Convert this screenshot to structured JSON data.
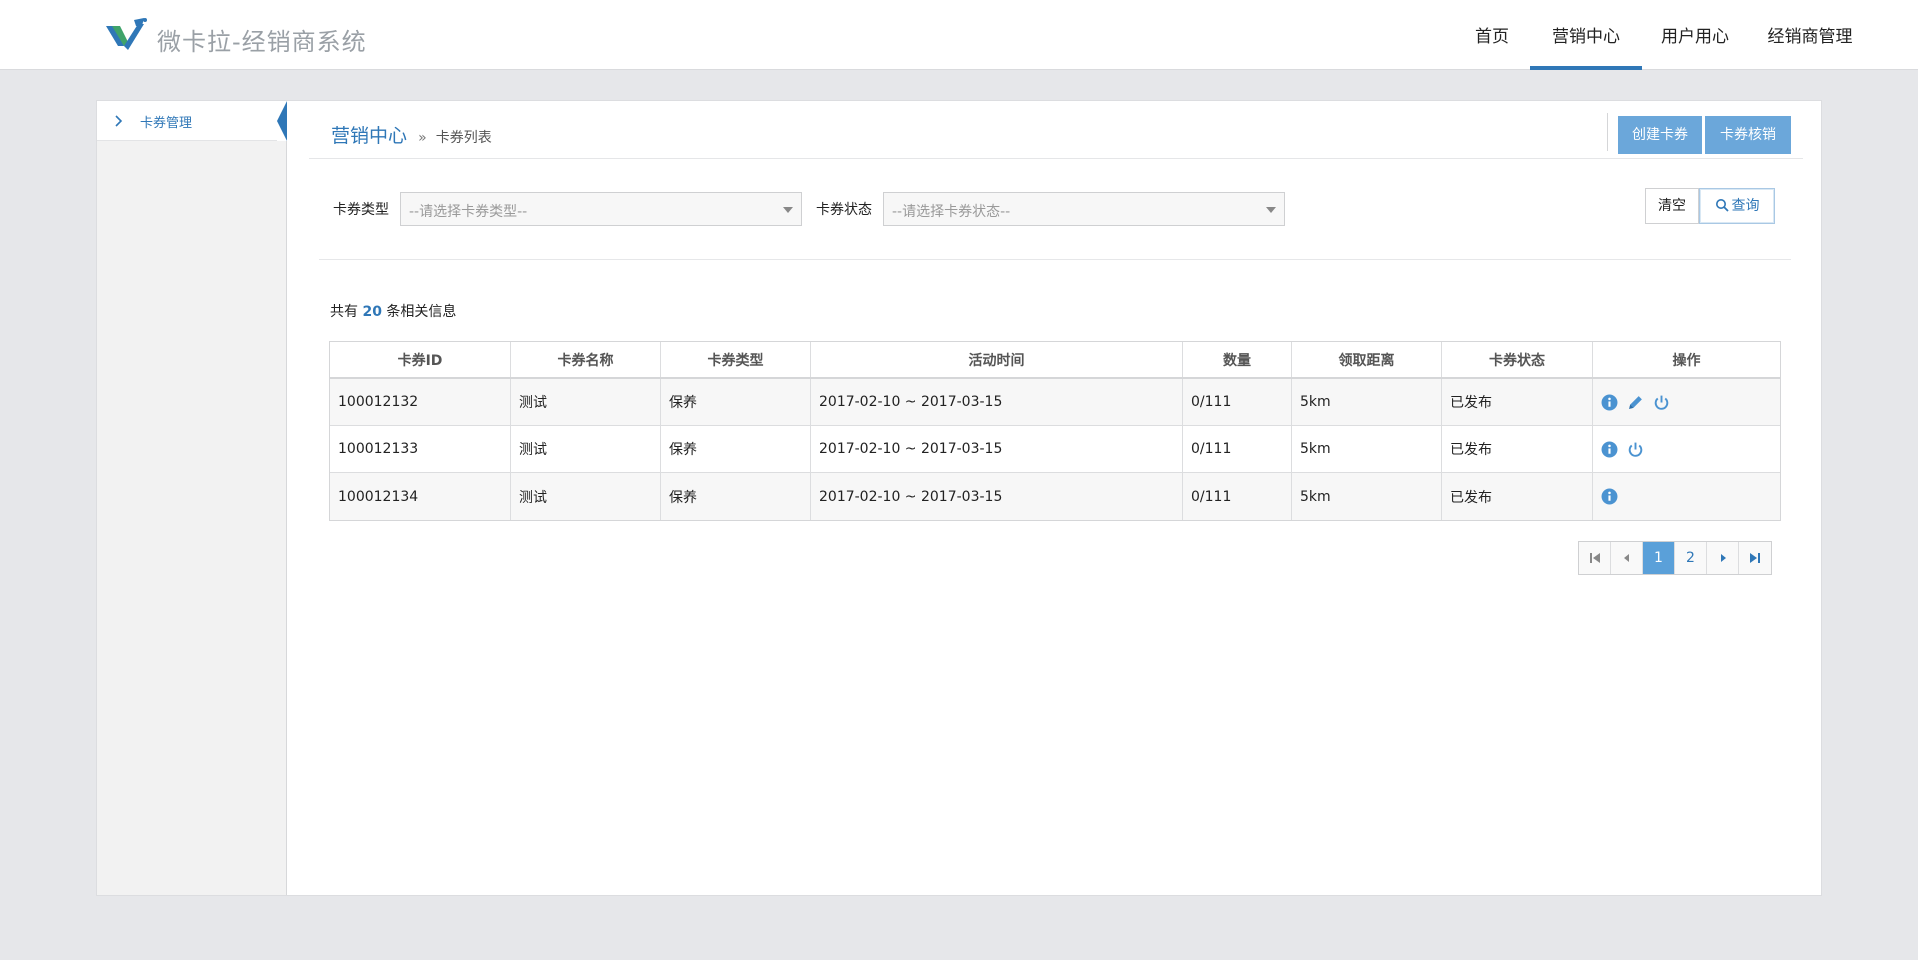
{
  "app": {
    "brand": "微卡拉-经销商系统",
    "logo_icon": "vk-logo-icon",
    "accent_color": "#2f77b7"
  },
  "nav": {
    "items": [
      {
        "label": "首页"
      },
      {
        "label": "营销中心",
        "active": true
      },
      {
        "label": "用户用心"
      },
      {
        "label": "经销商管理"
      }
    ]
  },
  "sidebar": {
    "items": [
      {
        "label": "卡券管理",
        "icon": "chevron-right-icon",
        "active": true
      }
    ]
  },
  "breadcrumb": {
    "main": "营销中心",
    "separator": "»",
    "sub": "卡券列表"
  },
  "header_actions": {
    "create_label": "创建卡券",
    "redeem_label": "卡券核销"
  },
  "filters": {
    "type_label": "卡券类型",
    "type_placeholder": "--请选择卡券类型--",
    "status_label": "卡券状态",
    "status_placeholder": "--请选择卡券状态--",
    "clear_label": "清空",
    "query_label": "查询"
  },
  "summary": {
    "prefix": "共有",
    "count": "20",
    "suffix": "条相关信息"
  },
  "table": {
    "headers": [
      "卡券ID",
      "卡券名称",
      "卡券类型",
      "活动时间",
      "数量",
      "领取距离",
      "卡券状态",
      "操作"
    ],
    "rows": [
      {
        "id": "100012132",
        "name": "测试",
        "type": "保养",
        "period": "2017-02-10 ~ 2017-03-15",
        "qty": "0/111",
        "distance": "5km",
        "status": "已发布",
        "actions": [
          "info-icon",
          "edit-icon",
          "power-icon"
        ]
      },
      {
        "id": "100012133",
        "name": "测试",
        "type": "保养",
        "period": "2017-02-10 ~ 2017-03-15",
        "qty": "0/111",
        "distance": "5km",
        "status": "已发布",
        "actions": [
          "info-icon",
          "power-icon"
        ]
      },
      {
        "id": "100012134",
        "name": "测试",
        "type": "保养",
        "period": "2017-02-10 ~ 2017-03-15",
        "qty": "0/111",
        "distance": "5km",
        "status": "已发布",
        "actions": [
          "info-icon"
        ]
      }
    ]
  },
  "pagination": {
    "current_page": "1",
    "pages": [
      "1",
      "2"
    ]
  }
}
